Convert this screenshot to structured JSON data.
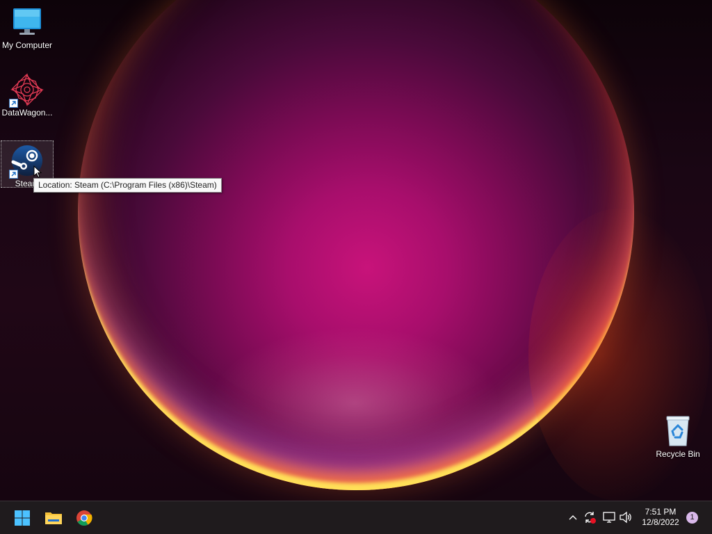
{
  "desktop": {
    "icons": [
      {
        "label": "My Computer"
      },
      {
        "label": "DataWagon..."
      },
      {
        "label": "Steam"
      },
      {
        "label": "Recycle Bin"
      }
    ],
    "tooltip": "Location: Steam (C:\\Program Files (x86)\\Steam)"
  },
  "taskbar": {
    "pinned": [
      {
        "name": "start-icon"
      },
      {
        "name": "file-explorer-icon"
      },
      {
        "name": "chrome-icon"
      }
    ],
    "tray": {
      "icons": [
        "chevron-up-icon",
        "sync-error-icon",
        "network-icon",
        "speaker-icon"
      ],
      "time": "7:51 PM",
      "date": "12/8/2022",
      "notification_count": "1"
    }
  },
  "colors": {
    "taskbar_bg": "#1f1b1d",
    "accent_blue": "#0078d4"
  }
}
